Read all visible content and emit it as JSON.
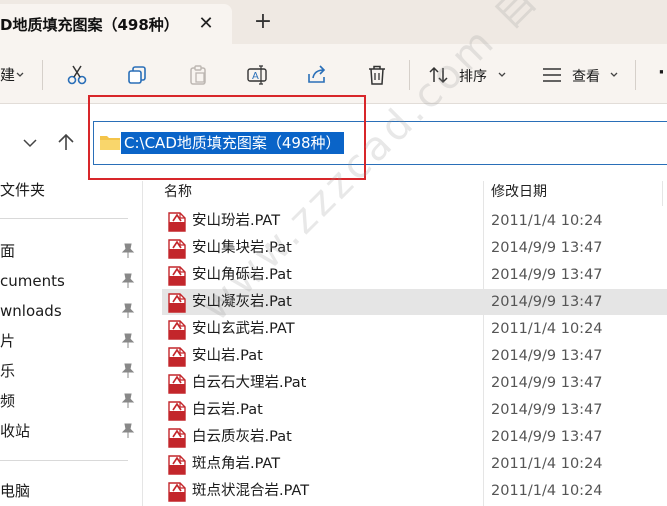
{
  "tab": {
    "title": "D地质填充图案（498种）",
    "close_icon": "close-icon",
    "new_tab_icon": "plus-icon"
  },
  "toolbar": {
    "new_label": "建",
    "sort_label": "排序",
    "view_label": "查看",
    "more_label": "·",
    "icons": [
      "cut-icon",
      "copy-icon",
      "paste-icon",
      "rename-icon",
      "share-icon",
      "delete-icon",
      "sort-icon",
      "view-icon"
    ]
  },
  "address": {
    "path": "C:\\CAD地质填充图案（498种）"
  },
  "sidebar": {
    "items": [
      {
        "label": "文件夹"
      },
      {
        "label": "面",
        "pinned": true
      },
      {
        "label": "cuments",
        "pinned": true
      },
      {
        "label": "wnloads",
        "pinned": true
      },
      {
        "label": "片",
        "pinned": true
      },
      {
        "label": "乐",
        "pinned": true
      },
      {
        "label": "频",
        "pinned": true
      },
      {
        "label": "收站",
        "pinned": true
      },
      {
        "label": "电脑"
      }
    ]
  },
  "list": {
    "columns": {
      "name": "名称",
      "modified": "修改日期"
    },
    "rows": [
      {
        "name": "安山玢岩.PAT",
        "date": "2011/1/4 10:24"
      },
      {
        "name": "安山集块岩.Pat",
        "date": "2014/9/9 13:47"
      },
      {
        "name": "安山角砾岩.Pat",
        "date": "2014/9/9 13:47"
      },
      {
        "name": "安山凝灰岩.Pat",
        "date": "2014/9/9 13:47",
        "selected": true
      },
      {
        "name": "安山玄武岩.PAT",
        "date": "2011/1/4 10:24"
      },
      {
        "name": "安山岩.Pat",
        "date": "2014/9/9 13:47"
      },
      {
        "name": "白云石大理岩.Pat",
        "date": "2014/9/9 13:47"
      },
      {
        "name": "白云岩.Pat",
        "date": "2014/9/9 13:47"
      },
      {
        "name": "白云质灰岩.Pat",
        "date": "2014/9/9 13:47"
      },
      {
        "name": "斑点角岩.PAT",
        "date": "2011/1/4 10:24"
      },
      {
        "name": "斑点状混合岩.PAT",
        "date": "2011/1/4 10:24"
      }
    ]
  },
  "watermark": "www.zzzcad.com 自学CAD",
  "colors": {
    "selection_blue": "#0a64c8",
    "highlight_red": "#d8262a",
    "file_icon_red": "#c3262b",
    "folder_yellow": "#f4c44a"
  }
}
